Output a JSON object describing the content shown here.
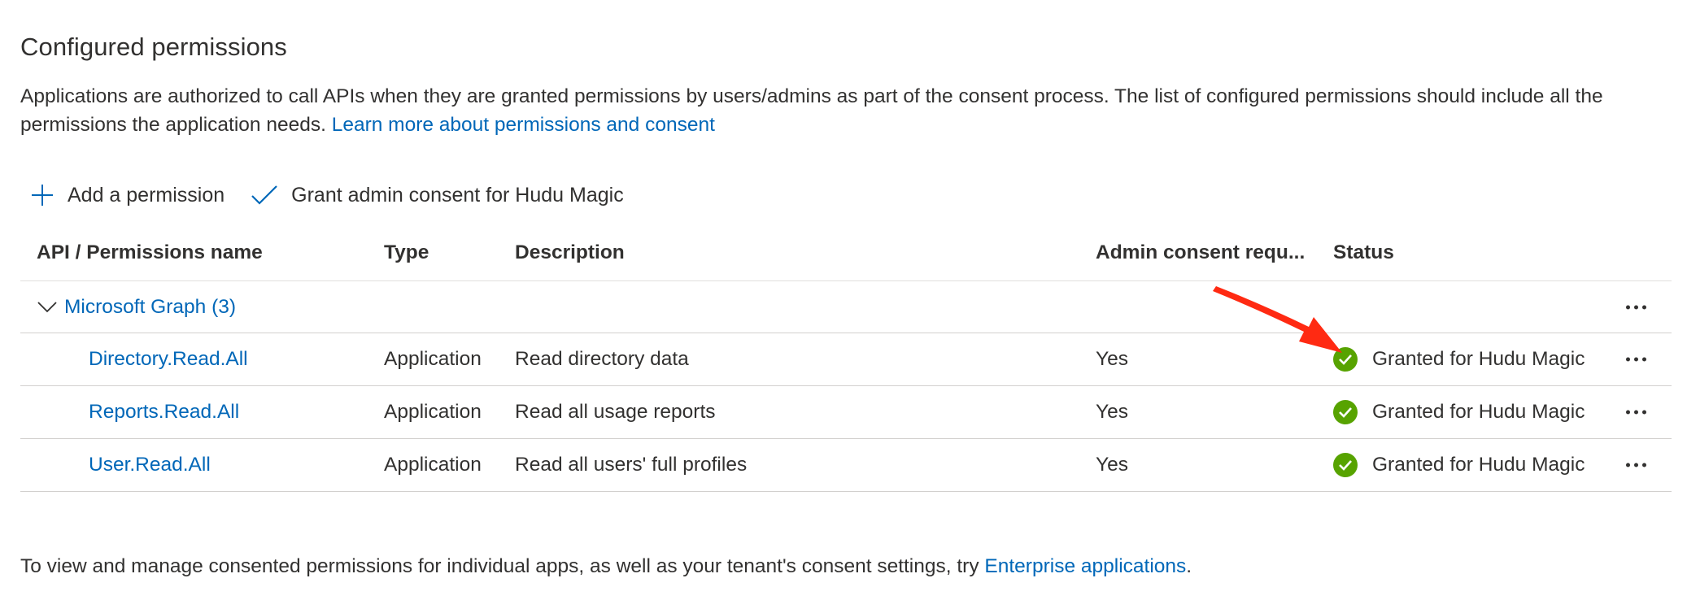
{
  "heading": "Configured permissions",
  "intro": {
    "text": "Applications are authorized to call APIs when they are granted permissions by users/admins as part of the consent process. The list of configured permissions should include all the permissions the application needs.",
    "link": "Learn more about permissions and consent"
  },
  "toolbar": {
    "add_label": "Add a permission",
    "grant_label": "Grant admin consent for Hudu Magic"
  },
  "table": {
    "columns": {
      "name": "API / Permissions name",
      "type": "Type",
      "description": "Description",
      "admin": "Admin consent requ...",
      "status": "Status"
    },
    "group": {
      "label": "Microsoft Graph (3)"
    },
    "rows": [
      {
        "name": "Directory.Read.All",
        "type": "Application",
        "description": "Read directory data",
        "admin": "Yes",
        "status": "Granted for Hudu Magic"
      },
      {
        "name": "Reports.Read.All",
        "type": "Application",
        "description": "Read all usage reports",
        "admin": "Yes",
        "status": "Granted for Hudu Magic"
      },
      {
        "name": "User.Read.All",
        "type": "Application",
        "description": "Read all users' full profiles",
        "admin": "Yes",
        "status": "Granted for Hudu Magic"
      }
    ]
  },
  "footer": {
    "text": "To view and manage consented permissions for individual apps, as well as your tenant's consent settings, try",
    "link": "Enterprise applications",
    "end": "."
  },
  "icons": {
    "add": "plus-icon",
    "grant": "checkmark-icon",
    "group_toggle": "chevron-down-icon",
    "status": "check-circle-icon",
    "more": "more-horizontal-icon",
    "annotation": "red-arrow"
  },
  "colors": {
    "link": "#0067b8",
    "success": "#57a300",
    "annotation": "#ff2a12",
    "text": "#323130"
  }
}
